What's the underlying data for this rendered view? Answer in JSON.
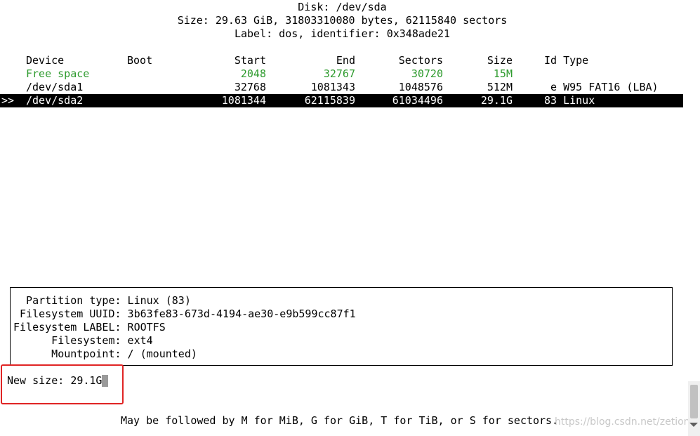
{
  "disk": {
    "title": "Disk: /dev/sda",
    "size": "Size: 29.63 GiB, 31803310080 bytes, 62115840 sectors",
    "label": "Label: dos, identifier: 0x348ade21"
  },
  "table": {
    "headers": {
      "device": "Device",
      "boot": "Boot",
      "start": "Start",
      "end": "End",
      "sectors": "Sectors",
      "size": "Size",
      "type": "Id Type"
    },
    "rows": [
      {
        "device": "Free space",
        "boot": "",
        "start": "2048",
        "end": "32767",
        "sectors": "30720",
        "size": "15M",
        "type": "",
        "free": true
      },
      {
        "device": "/dev/sda1",
        "boot": "",
        "start": "32768",
        "end": "1081343",
        "sectors": "1048576",
        "size": "512M",
        "type": " e W95 FAT16 (LBA)"
      },
      {
        "device": "/dev/sda2",
        "boot": "",
        "start": "1081344",
        "end": "62115839",
        "sectors": "61034496",
        "size": "29.1G",
        "type": "83 Linux",
        "selected": true
      }
    ],
    "selection_marker": ">>"
  },
  "info": {
    "partition_type": "  Partition type: Linux (83)",
    "fs_uuid": " Filesystem UUID: 3b63fe83-673d-4194-ae30-e9b599cc87f1",
    "fs_label": "Filesystem LABEL: ROOTFS",
    "filesystem": "      Filesystem: ext4",
    "mountpoint": "      Mountpoint: / (mounted)"
  },
  "prompt": {
    "label": "New size: ",
    "value": "29.1G"
  },
  "hint": "May be followed by M for MiB, G for GiB, T for TiB, or S for sectors.",
  "watermark": "https://blog.csdn.net/zetion_",
  "colors": {
    "free_space": "#2e9b2e",
    "selection_bg": "#000000",
    "highlight_box": "#e02424"
  }
}
